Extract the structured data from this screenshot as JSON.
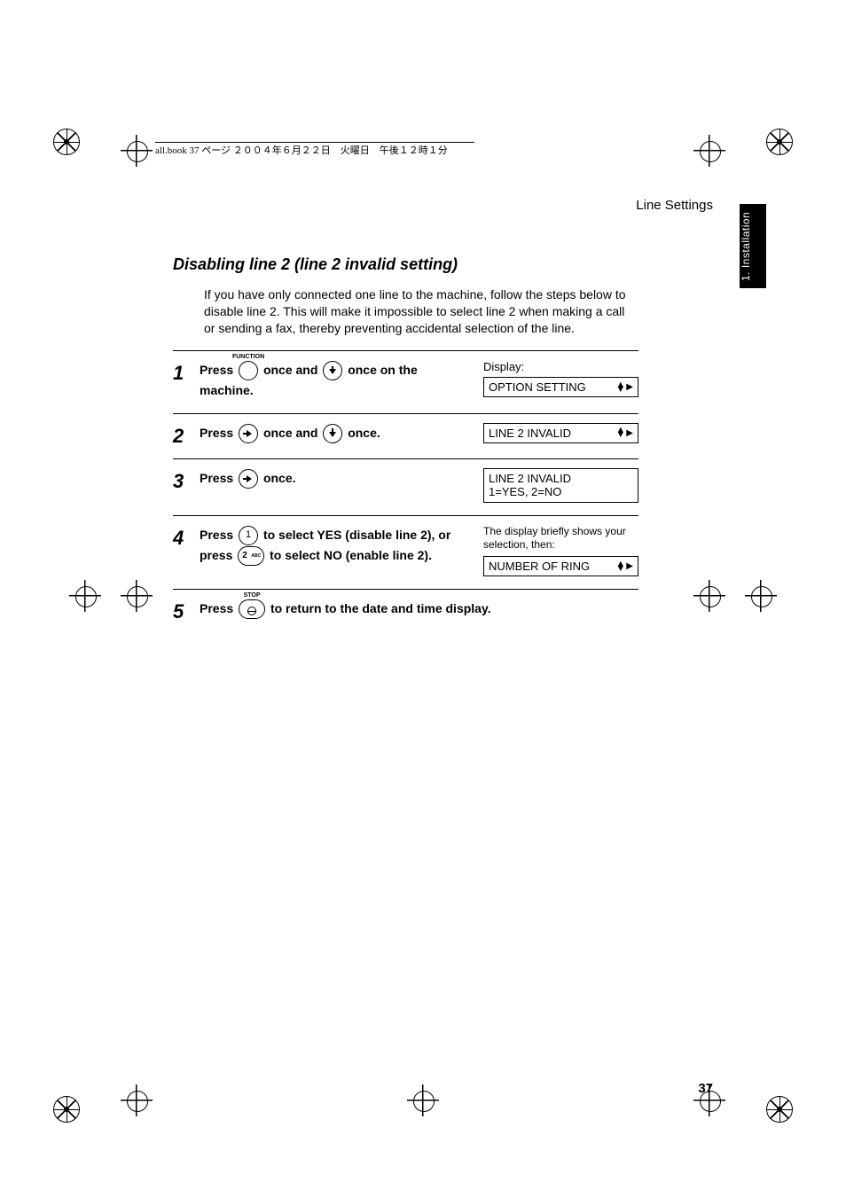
{
  "header_line": "all.book  37 ページ  ２００４年６月２２日　火曜日　午後１２時１分",
  "running_head": "Line Settings",
  "side_tab": "1. Installation",
  "section_title": "Disabling line 2 (line 2 invalid setting)",
  "intro": "If you have only connected one line to the machine, follow the steps below to disable line 2. This will make it impossible to select line 2 when making a call or sending a fax, thereby preventing accidental selection of the line.",
  "steps": [
    {
      "num": "1",
      "text_before": "Press ",
      "key1_label": "FUNCTION",
      "text_mid1": " once and ",
      "text_mid2": " once on the machine.",
      "display_label": "Display:",
      "display_box": "OPTION SETTING"
    },
    {
      "num": "2",
      "text_before": "Press ",
      "text_mid1": " once and ",
      "text_mid2": " once.",
      "display_box": "LINE 2 INVALID"
    },
    {
      "num": "3",
      "text_before": "Press ",
      "text_mid2": " once.",
      "display_box_l1": "LINE 2 INVALID",
      "display_box_l2": "1=YES, 2=NO"
    },
    {
      "num": "4",
      "text_before": "Press ",
      "key_num1": "1",
      "text_mid1": " to select YES (disable line 2), or press ",
      "key_num2": "2",
      "text_mid2": " to select NO (enable line 2).",
      "display_note": "The display briefly shows your selection, then:",
      "display_box": "NUMBER OF RING"
    },
    {
      "num": "5",
      "text_before": "Press ",
      "key1_label": "STOP",
      "text_mid2": " to return to the date and time display."
    }
  ],
  "page_number": "37"
}
